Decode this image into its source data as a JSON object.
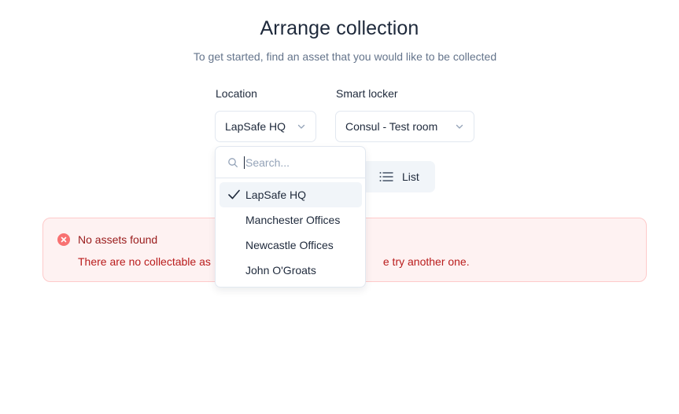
{
  "page": {
    "title": "Arrange collection",
    "subtitle": "To get started, find an asset that you would like to be collected"
  },
  "filters": {
    "location": {
      "label": "Location",
      "value": "LapSafe HQ"
    },
    "smart_locker": {
      "label": "Smart locker",
      "value": "Consul - Test room"
    }
  },
  "view_toggle": {
    "list_label": "List",
    "icon": "list-icon"
  },
  "alert": {
    "status_color": "#ef4444",
    "icon": "x-circle-icon",
    "title": "No assets found",
    "message_left": "There are no collectable as",
    "message_right": "e try another one."
  },
  "location_dropdown": {
    "search_placeholder": "Search...",
    "options": [
      {
        "label": "LapSafe HQ",
        "selected": true
      },
      {
        "label": "Manchester Offices",
        "selected": false
      },
      {
        "label": "Newcastle Offices",
        "selected": false
      },
      {
        "label": "John O'Groats",
        "selected": false
      }
    ]
  }
}
